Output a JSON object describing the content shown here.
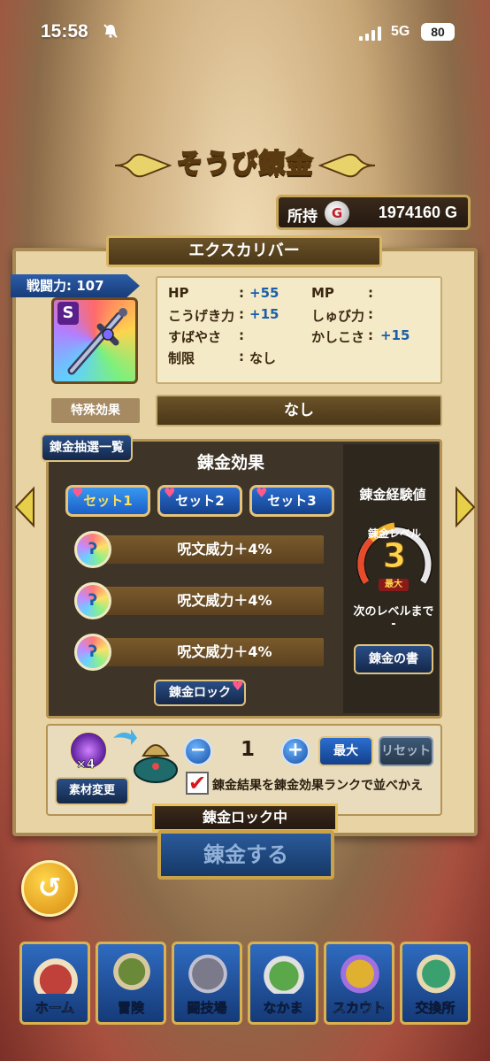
{
  "status_bar": {
    "time": "15:58",
    "network": "5G",
    "battery": "80"
  },
  "header": {
    "title": "そうび錬金"
  },
  "money": {
    "label": "所持",
    "coin_glyph": "G",
    "amount": "1974160 G"
  },
  "item": {
    "name": "エクスカリバー",
    "power": "戦闘力: 107",
    "rank": "S",
    "stats": [
      {
        "label": "HP",
        "colon": ":",
        "value": "+55"
      },
      {
        "label": "MP",
        "colon": ":",
        "value": ""
      },
      {
        "label": "こうげき力",
        "colon": ":",
        "value": "+15"
      },
      {
        "label": "しゅび力",
        "colon": ":",
        "value": ""
      },
      {
        "label": "すばやさ",
        "colon": ":",
        "value": ""
      },
      {
        "label": "かしこさ",
        "colon": ":",
        "value": "+15"
      },
      {
        "label": "制限",
        "colon": ":",
        "value": "なし"
      }
    ],
    "special_label": "特殊効果",
    "special_value": "なし"
  },
  "effects": {
    "list_button": "錬金抽選一覧",
    "title": "錬金効果",
    "sets": [
      "セット1",
      "セット2",
      "セット3"
    ],
    "active_set": 0,
    "rows": [
      "呪文威力＋4%",
      "呪文威力＋4%",
      "呪文威力＋4%"
    ],
    "lock_button": "錬金ロック"
  },
  "experience": {
    "title": "錬金経験値",
    "level_label": "錬金レベル",
    "level": "3",
    "max_badge": "最大",
    "next_label": "次のレベルまで",
    "next_value": "-",
    "book_button": "錬金の書",
    "gauge_fill": 1.0
  },
  "material": {
    "count": "×4",
    "change_button": "素材変更",
    "minus": "−",
    "quantity": "1",
    "plus": "+",
    "max_button": "最大",
    "reset_button": "リセット",
    "checkbox_checked": true,
    "checkbox_mark": "✔",
    "checkbox_label": "錬金結果を錬金効果ランクで並べかえ"
  },
  "action": {
    "lock_state": "錬金ロック中",
    "refine_button": "錬金する",
    "back_glyph": "↺"
  },
  "nav": [
    {
      "label": "ホーム",
      "color": "#c0403a"
    },
    {
      "label": "冒険",
      "color": "#6a8a3a"
    },
    {
      "label": "闘技場",
      "color": "#7a7a8a"
    },
    {
      "label": "なかま",
      "color": "#5aa84a"
    },
    {
      "label": "スカウト",
      "color": "#e0b030"
    },
    {
      "label": "交換所",
      "color": "#3aa070"
    }
  ],
  "colors": {
    "accent_gold": "#d8b150",
    "stat_blue": "#1a5fa8",
    "panel": "#e7d3a4"
  }
}
